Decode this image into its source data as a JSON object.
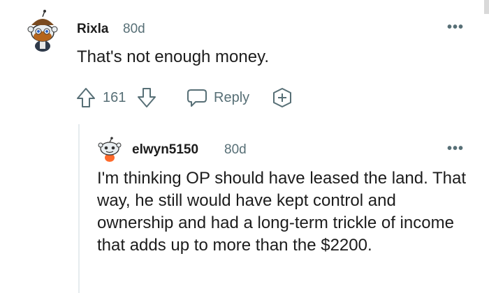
{
  "colors": {
    "text": "#1c1c1c",
    "muted": "#576f76",
    "thread_line": "#e5ebee"
  },
  "comment": {
    "username": "Rixla",
    "age": "80d",
    "more_icon": "more-horizontal-icon",
    "text": "That's not enough money.",
    "vote_count": "161",
    "upvote_icon": "arrow-up-icon",
    "downvote_icon": "arrow-down-icon",
    "reply_icon": "speech-bubble-icon",
    "reply_label": "Reply",
    "award_icon": "add-award-icon"
  },
  "reply": {
    "username": "elwyn5150",
    "age": "80d",
    "more_icon": "more-horizontal-icon",
    "text": "I'm thinking OP should have leased the land. That way, he still would have kept control and ownership and had a long-term trickle of income that adds up to more than the $2200."
  }
}
